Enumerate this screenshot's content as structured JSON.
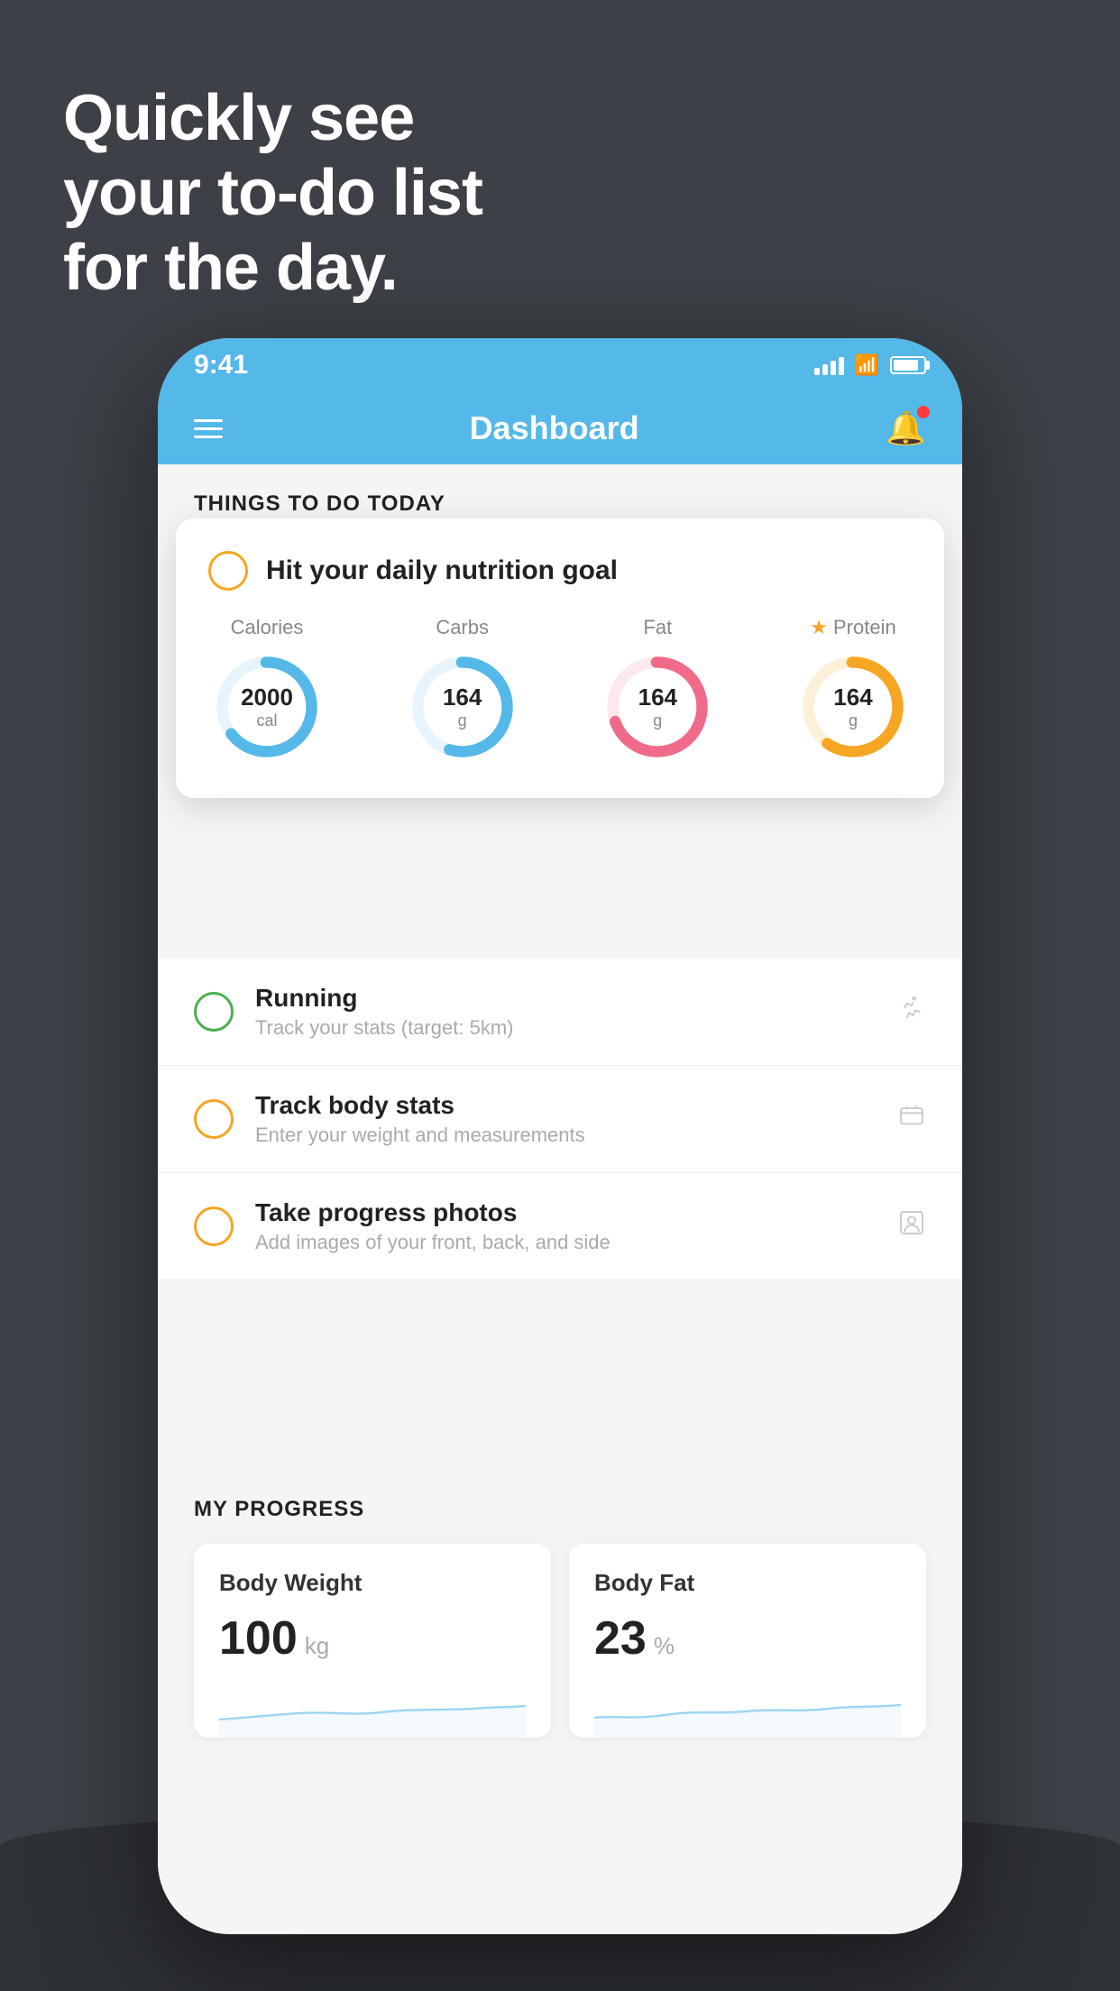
{
  "hero": {
    "line1": "Quickly see",
    "line2": "your to-do list",
    "line3": "for the day."
  },
  "status_bar": {
    "time": "9:41"
  },
  "nav": {
    "title": "Dashboard"
  },
  "things_section": {
    "title": "THINGS TO DO TODAY"
  },
  "floating_card": {
    "title": "Hit your daily nutrition goal",
    "nutrition": [
      {
        "label": "Calories",
        "value": "2000",
        "unit": "cal",
        "color": "#54b8e8",
        "percent": 65,
        "starred": false
      },
      {
        "label": "Carbs",
        "value": "164",
        "unit": "g",
        "color": "#54b8e8",
        "percent": 55,
        "starred": false
      },
      {
        "label": "Fat",
        "value": "164",
        "unit": "g",
        "color": "#f06b8a",
        "percent": 70,
        "starred": false
      },
      {
        "label": "Protein",
        "value": "164",
        "unit": "g",
        "color": "#f5a623",
        "percent": 60,
        "starred": true
      }
    ]
  },
  "todo_items": [
    {
      "name": "Running",
      "desc": "Track your stats (target: 5km)",
      "icon": "👟",
      "checkbox_color": "green"
    },
    {
      "name": "Track body stats",
      "desc": "Enter your weight and measurements",
      "icon": "⚖️",
      "checkbox_color": "yellow"
    },
    {
      "name": "Take progress photos",
      "desc": "Add images of your front, back, and side",
      "icon": "👤",
      "checkbox_color": "yellow"
    }
  ],
  "progress_section": {
    "title": "MY PROGRESS",
    "cards": [
      {
        "title": "Body Weight",
        "value": "100",
        "unit": "kg"
      },
      {
        "title": "Body Fat",
        "value": "23",
        "unit": "%"
      }
    ]
  }
}
